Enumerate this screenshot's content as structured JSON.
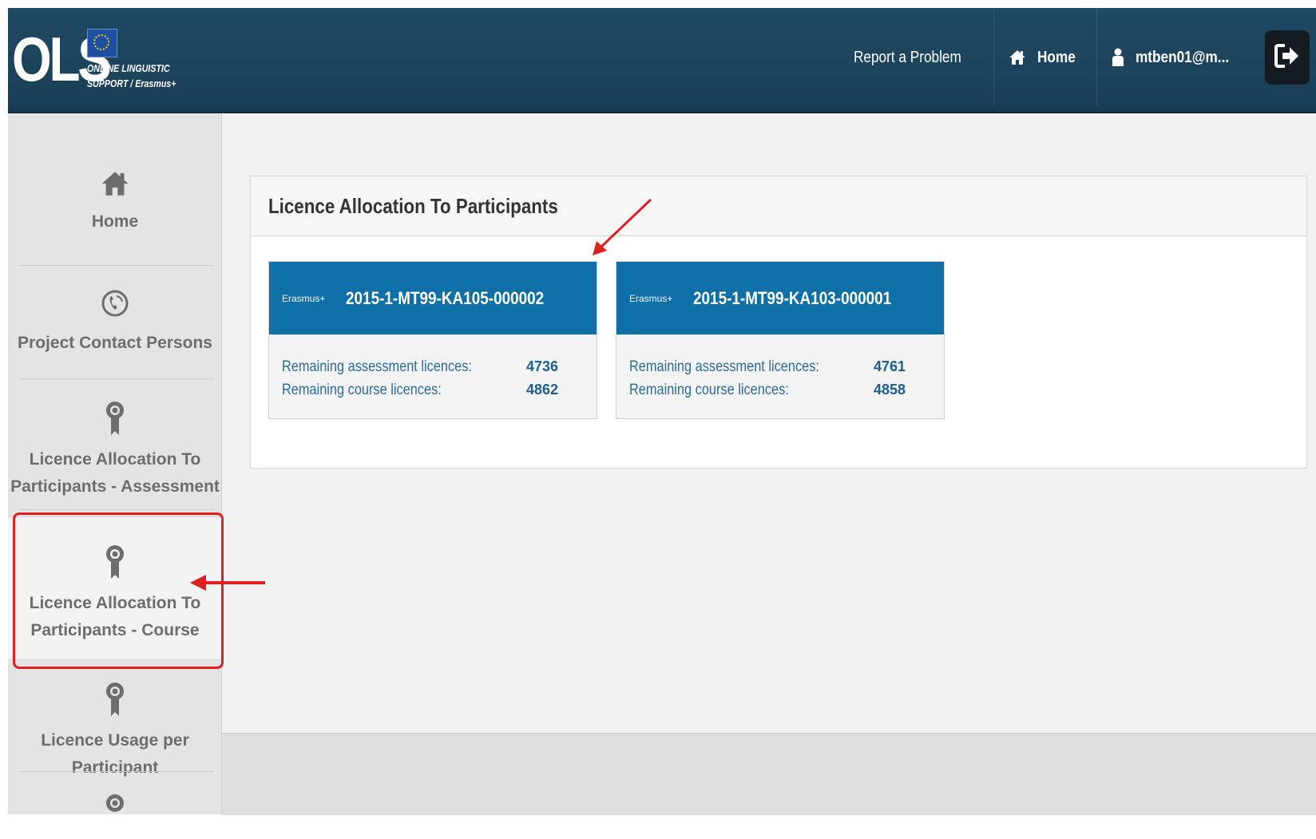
{
  "header": {
    "logo_text": "OLS",
    "logo_line1": "ONLINE LINGUISTIC",
    "logo_line2": "SUPPORT / Erasmus+",
    "report_problem": "Report a Problem",
    "home": "Home",
    "user": "mtben01@m..."
  },
  "sidebar": {
    "items": [
      {
        "label": "Home",
        "icon": "home-icon"
      },
      {
        "label": "Project Contact Persons",
        "icon": "phone-icon"
      },
      {
        "label_line1": "Licence Allocation To",
        "label_line2": "Participants - Assessment",
        "icon": "award-icon"
      },
      {
        "label_line1": "Licence Allocation To",
        "label_line2": "Participants - Course",
        "icon": "award-icon",
        "active": true
      },
      {
        "label": "Licence Usage per Participant",
        "icon": "award-icon"
      }
    ]
  },
  "panel": {
    "title": "Licence Allocation To Participants"
  },
  "cards": [
    {
      "brand": "Erasmus+",
      "code": "2015-1-MT99-KA105-000002",
      "assessment_label": "Remaining assessment licences:",
      "assessment_value": "4736",
      "course_label": "Remaining course licences:",
      "course_value": "4862"
    },
    {
      "brand": "Erasmus+",
      "code": "2015-1-MT99-KA103-000001",
      "assessment_label": "Remaining assessment licences:",
      "assessment_value": "4761",
      "course_label": "Remaining course licences:",
      "course_value": "4858"
    }
  ],
  "colors": {
    "header_bg": "#1f4a64",
    "card_header": "#0f70a7",
    "annotation": "#e02020",
    "sidebar_bg": "#e4e4e4"
  }
}
